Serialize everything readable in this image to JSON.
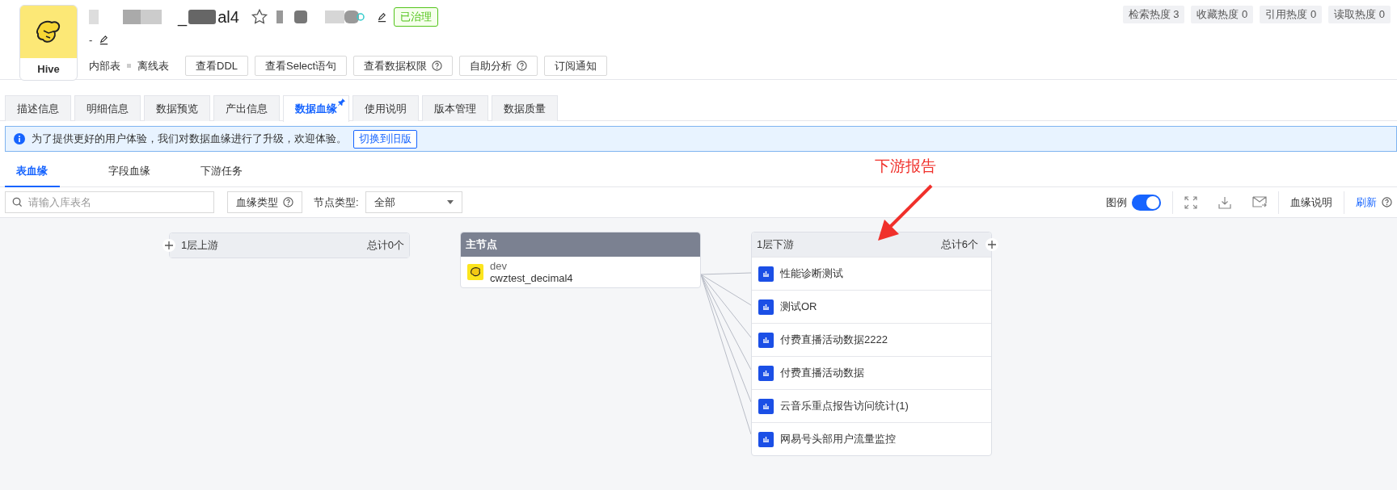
{
  "asset": {
    "type_label": "Hive",
    "title_prefix": "_",
    "title_suffix": "al4",
    "starred": false,
    "governance_badge": "已治理",
    "description": "-",
    "table_tags": [
      "内部表",
      "离线表"
    ],
    "actions": [
      {
        "label": "查看DDL",
        "help": false
      },
      {
        "label": "查看Select语句",
        "help": false
      },
      {
        "label": "查看数据权限",
        "help": true
      },
      {
        "label": "自助分析",
        "help": true
      },
      {
        "label": "订阅通知",
        "help": false
      }
    ],
    "heat": [
      "检索热度 3",
      "收藏热度 0",
      "引用热度 0",
      "读取热度 0"
    ]
  },
  "tabs": [
    {
      "label": "描述信息",
      "selected": false,
      "pinned": false
    },
    {
      "label": "明细信息",
      "selected": false,
      "pinned": false
    },
    {
      "label": "数据预览",
      "selected": false,
      "pinned": false
    },
    {
      "label": "产出信息",
      "selected": false,
      "pinned": false
    },
    {
      "label": "数据血缘",
      "selected": true,
      "pinned": true
    },
    {
      "label": "使用说明",
      "selected": false,
      "pinned": false
    },
    {
      "label": "版本管理",
      "selected": false,
      "pinned": false
    },
    {
      "label": "数据质量",
      "selected": false,
      "pinned": false
    }
  ],
  "banner": {
    "message": "为了提供更好的用户体验，我们对数据血缘进行了升级，欢迎体验。",
    "action": "切换到旧版"
  },
  "sub_tabs": [
    {
      "label": "表血缘",
      "selected": true
    },
    {
      "label": "字段血缘",
      "selected": false
    },
    {
      "label": "下游任务",
      "selected": false
    }
  ],
  "toolbar": {
    "search_placeholder": "请输入库表名",
    "lineage_type": "血缘类型",
    "node_type_label": "节点类型:",
    "node_type_value": "全部",
    "legend_label": "图例",
    "legend_on": true,
    "lineage_help": "血缘说明",
    "refresh": "刷新"
  },
  "graph": {
    "upstream": {
      "title": "1层上游",
      "total": "总计0个"
    },
    "main_node": {
      "title": "主节点",
      "database": "dev",
      "table": "cwztest_decimal4"
    },
    "downstream": {
      "title": "1层下游",
      "total": "总计6个",
      "items": [
        {
          "name": "性能诊断测试"
        },
        {
          "name": "测试OR"
        },
        {
          "name": "付费直播活动数据2222"
        },
        {
          "name": "付费直播活动数据"
        },
        {
          "name": "云音乐重点报告访问统计(1)"
        },
        {
          "name": "网易号头部用户流量监控"
        }
      ]
    }
  },
  "annotation": {
    "text": "下游报告"
  }
}
